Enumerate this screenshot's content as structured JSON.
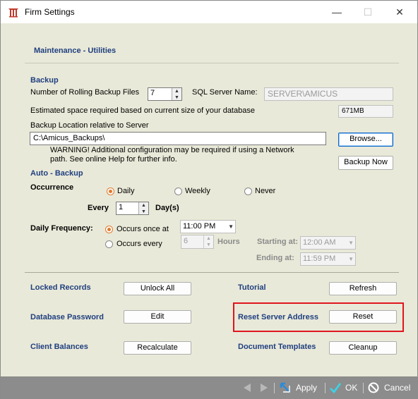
{
  "window": {
    "title": "Firm Settings",
    "minimize": "—",
    "maximize": "☐",
    "close": "✕"
  },
  "breadcrumb": "Maintenance - Utilities",
  "backup": {
    "header": "Backup",
    "rolling_label": "Number of Rolling Backup Files",
    "rolling_value": "7",
    "sql_label": "SQL Server Name:",
    "sql_value": "SERVER\\AMICUS",
    "estimate_label": "Estimated space required based on current size of your database",
    "estimate_value": "671MB",
    "location_label": "Backup Location relative to Server",
    "location_value": "C:\\Amicus_Backups\\",
    "browse_label": "Browse...",
    "warning_line1": "WARNING! Additional configuration may be required if using a Network",
    "warning_line2": "path. See online Help for further info.",
    "backup_now_label": "Backup Now"
  },
  "auto_backup": {
    "header": "Auto - Backup",
    "occurrence_label": "Occurrence",
    "options": [
      "Daily",
      "Weekly",
      "Never"
    ],
    "selected": "Daily",
    "every_label": "Every",
    "every_value": "1",
    "days_label": "Day(s)",
    "frequency_label": "Daily Frequency:",
    "once_label": "Occurs once at",
    "once_value": "11:00 PM",
    "every_freq_label": "Occurs every",
    "every_freq_value": "6",
    "hours_label": "Hours",
    "starting_label": "Starting at:",
    "starting_value": "12:00 AM",
    "ending_label": "Ending at:",
    "ending_value": "11:59 PM"
  },
  "utilities": {
    "locked_label": "Locked Records",
    "locked_btn": "Unlock All",
    "tutorial_label": "Tutorial",
    "tutorial_btn": "Refresh",
    "dbpass_label": "Database Password",
    "dbpass_btn": "Edit",
    "reset_label": "Reset Server Address",
    "reset_btn": "Reset",
    "balances_label": "Client Balances",
    "balances_btn": "Recalculate",
    "templates_label": "Document Templates",
    "templates_btn": "Cleanup"
  },
  "footer": {
    "apply": "Apply",
    "ok": "OK",
    "cancel": "Cancel"
  },
  "colors": {
    "section_header": "#1f3f7f",
    "highlight": "#e0141e",
    "footer": "#8c8c8c"
  }
}
